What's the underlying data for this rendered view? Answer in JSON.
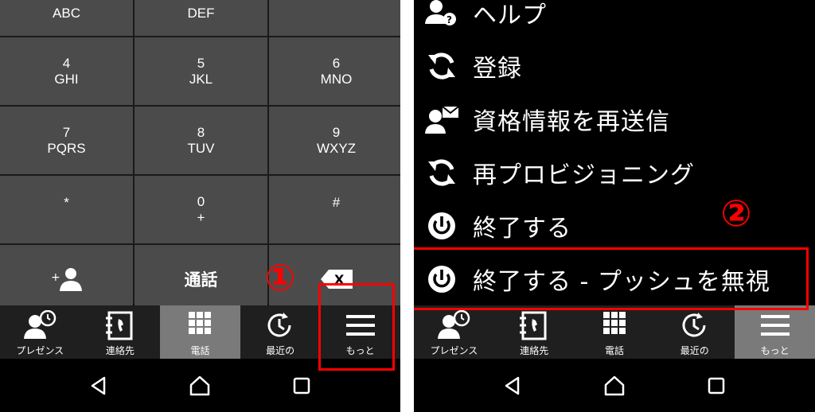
{
  "left": {
    "keypad": [
      {
        "digit": "",
        "letters": "ABC"
      },
      {
        "digit": "",
        "letters": "DEF"
      },
      {
        "digit": "",
        "letters": ""
      },
      {
        "digit": "4",
        "letters": "GHI"
      },
      {
        "digit": "5",
        "letters": "JKL"
      },
      {
        "digit": "6",
        "letters": "MNO"
      },
      {
        "digit": "7",
        "letters": "PQRS"
      },
      {
        "digit": "8",
        "letters": "TUV"
      },
      {
        "digit": "9",
        "letters": "WXYZ"
      },
      {
        "digit": "*",
        "letters": ""
      },
      {
        "digit": "0",
        "letters": "+"
      },
      {
        "digit": "#",
        "letters": ""
      }
    ],
    "call_label": "通話",
    "annotation_number": "①"
  },
  "right": {
    "menu": [
      {
        "label": "ヘルプ",
        "icon": "help-user-icon"
      },
      {
        "label": "登録",
        "icon": "refresh-icon"
      },
      {
        "label": "資格情報を再送信",
        "icon": "user-mail-icon"
      },
      {
        "label": "再プロビジョニング",
        "icon": "refresh-icon"
      },
      {
        "label": "終了する",
        "icon": "power-icon"
      },
      {
        "label": "終了する - プッシュを無視",
        "icon": "power-icon"
      }
    ],
    "annotation_number": "②"
  },
  "nav": {
    "presence": "プレゼンス",
    "contacts": "連絡先",
    "phone": "電話",
    "recent": "最近の",
    "more": "もっと"
  },
  "colors": {
    "key_bg": "#4b4b4b",
    "nav_active": "#7a7a7a",
    "annotation": "#ff0000"
  }
}
